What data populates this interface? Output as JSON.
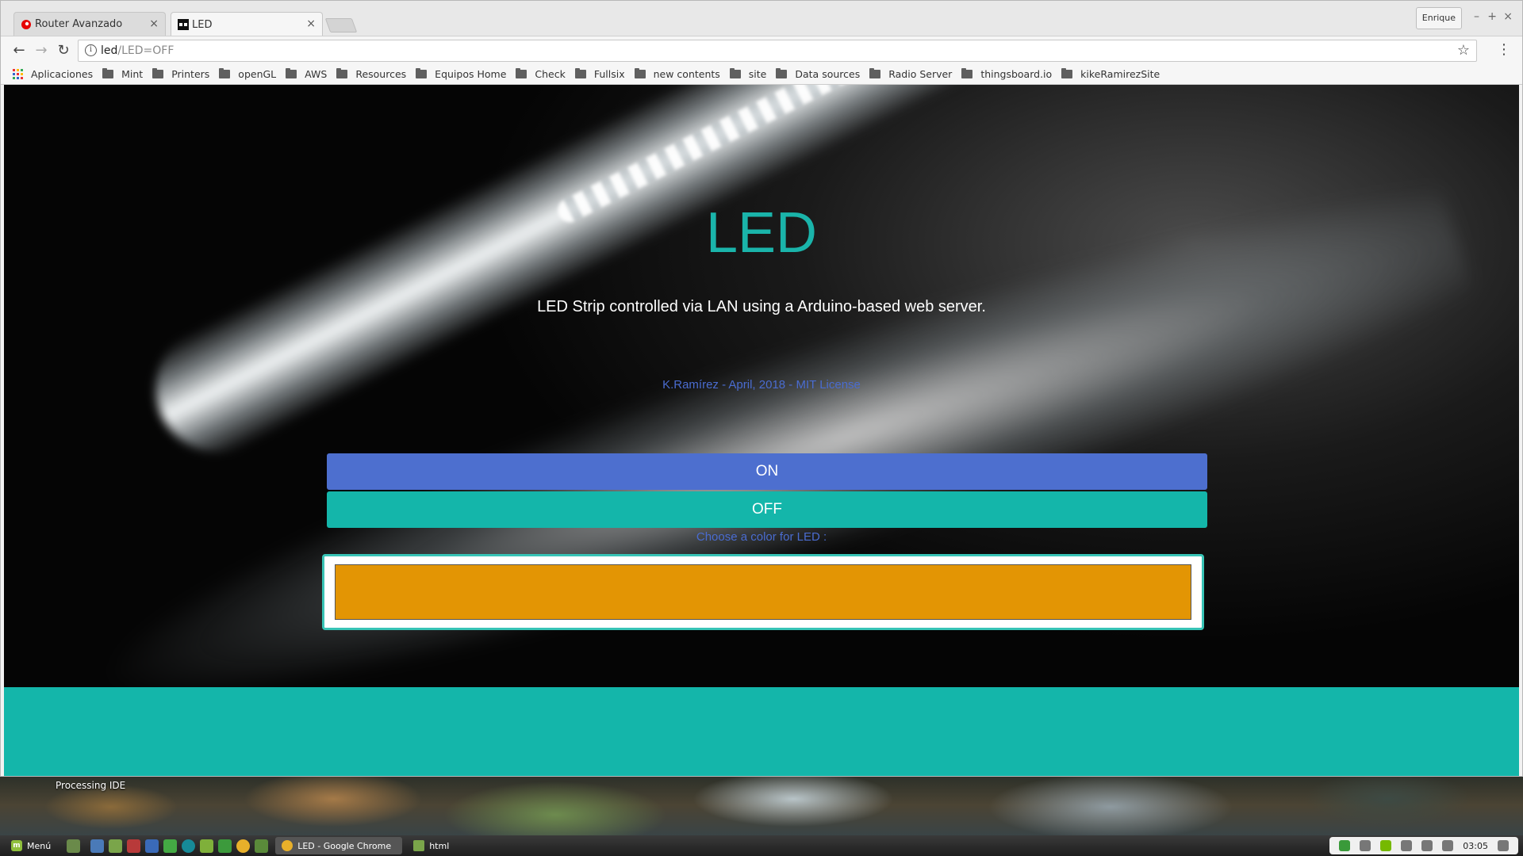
{
  "desktop": {
    "label": "Processing IDE"
  },
  "browser": {
    "tabs": [
      {
        "title": "Router Avanzado",
        "active": false
      },
      {
        "title": "LED",
        "active": true
      }
    ],
    "profile": "Enrique",
    "address": {
      "host": "led",
      "path": "/LED=OFF"
    },
    "bookmarks": [
      {
        "label": "Aplicaciones",
        "icon": "apps-icon"
      },
      {
        "label": "Mint",
        "icon": "folder-icon"
      },
      {
        "label": "Printers",
        "icon": "folder-icon"
      },
      {
        "label": "openGL",
        "icon": "folder-icon"
      },
      {
        "label": "AWS",
        "icon": "folder-icon"
      },
      {
        "label": "Resources",
        "icon": "folder-icon"
      },
      {
        "label": "Equipos Home",
        "icon": "folder-icon"
      },
      {
        "label": "Check",
        "icon": "folder-icon"
      },
      {
        "label": "Fullsix",
        "icon": "folder-icon"
      },
      {
        "label": "new contents",
        "icon": "folder-icon"
      },
      {
        "label": "site",
        "icon": "folder-icon"
      },
      {
        "label": "Data sources",
        "icon": "folder-icon"
      },
      {
        "label": "Radio Server",
        "icon": "folder-icon"
      },
      {
        "label": "thingsboard.io",
        "icon": "folder-icon"
      },
      {
        "label": "kikeRamirezSite",
        "icon": "folder-icon"
      }
    ]
  },
  "page": {
    "title": "LED",
    "subtitle": "LED Strip controlled via LAN using a Arduino-based web server.",
    "credit": "K.Ramírez - April, 2018 - MIT License",
    "on_label": "ON",
    "off_label": "OFF",
    "color_label": "Choose a color for LED :",
    "selected_color": "#e39504",
    "colors": {
      "accent": "#14b6aa",
      "title": "#1ab4aa",
      "on_button": "#4d6fcf",
      "link": "#4a6cd0"
    }
  },
  "taskbar": {
    "menu_label": "Menú",
    "windows": [
      {
        "label": "LED - Google Chrome",
        "active": true
      },
      {
        "label": "html",
        "active": false
      }
    ],
    "clock": "03:05"
  }
}
